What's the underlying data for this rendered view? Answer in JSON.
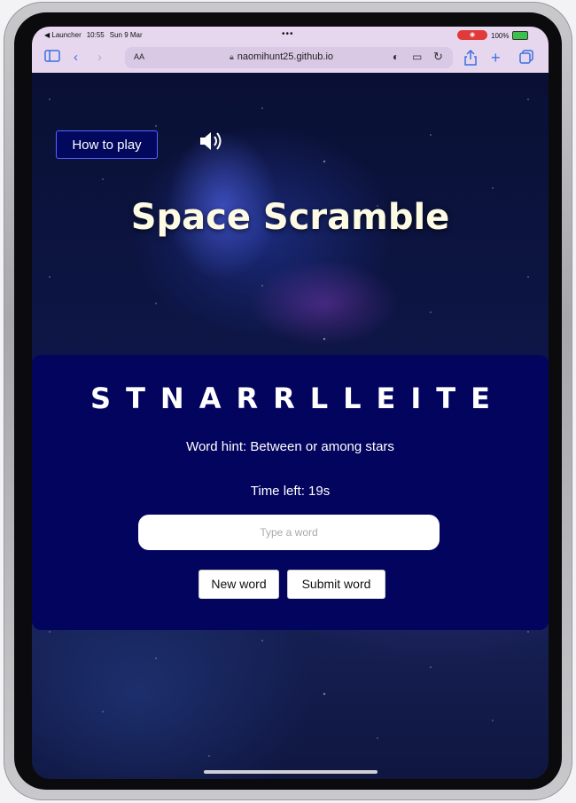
{
  "status_bar": {
    "back_app": "◀ Launcher",
    "time": "10:55",
    "date": "Sun 9 Mar",
    "battery": "100%"
  },
  "browser": {
    "text_size_label": "AA",
    "url": "naomihunt25.github.io"
  },
  "game": {
    "how_to_play_label": "How to play",
    "title": "Space Scramble",
    "scrambled_word": "STNARRLLEITE",
    "hint": "Word hint: Between or among stars",
    "timer": "Time left: 19s",
    "input_placeholder": "Type a word",
    "new_word_label": "New word",
    "submit_label": "Submit word"
  },
  "colors": {
    "card_bg": "#03045e",
    "title_color": "#fdfbe3",
    "toolbar_bg": "#e6d7ef",
    "accent_blue": "#3b6fe0"
  },
  "icons": [
    "sidebar-icon",
    "back-icon",
    "forward-icon",
    "lock-icon",
    "extension-icon",
    "reader-icon",
    "reload-icon",
    "share-icon",
    "new-tab-icon",
    "tabs-icon",
    "sound-icon"
  ]
}
